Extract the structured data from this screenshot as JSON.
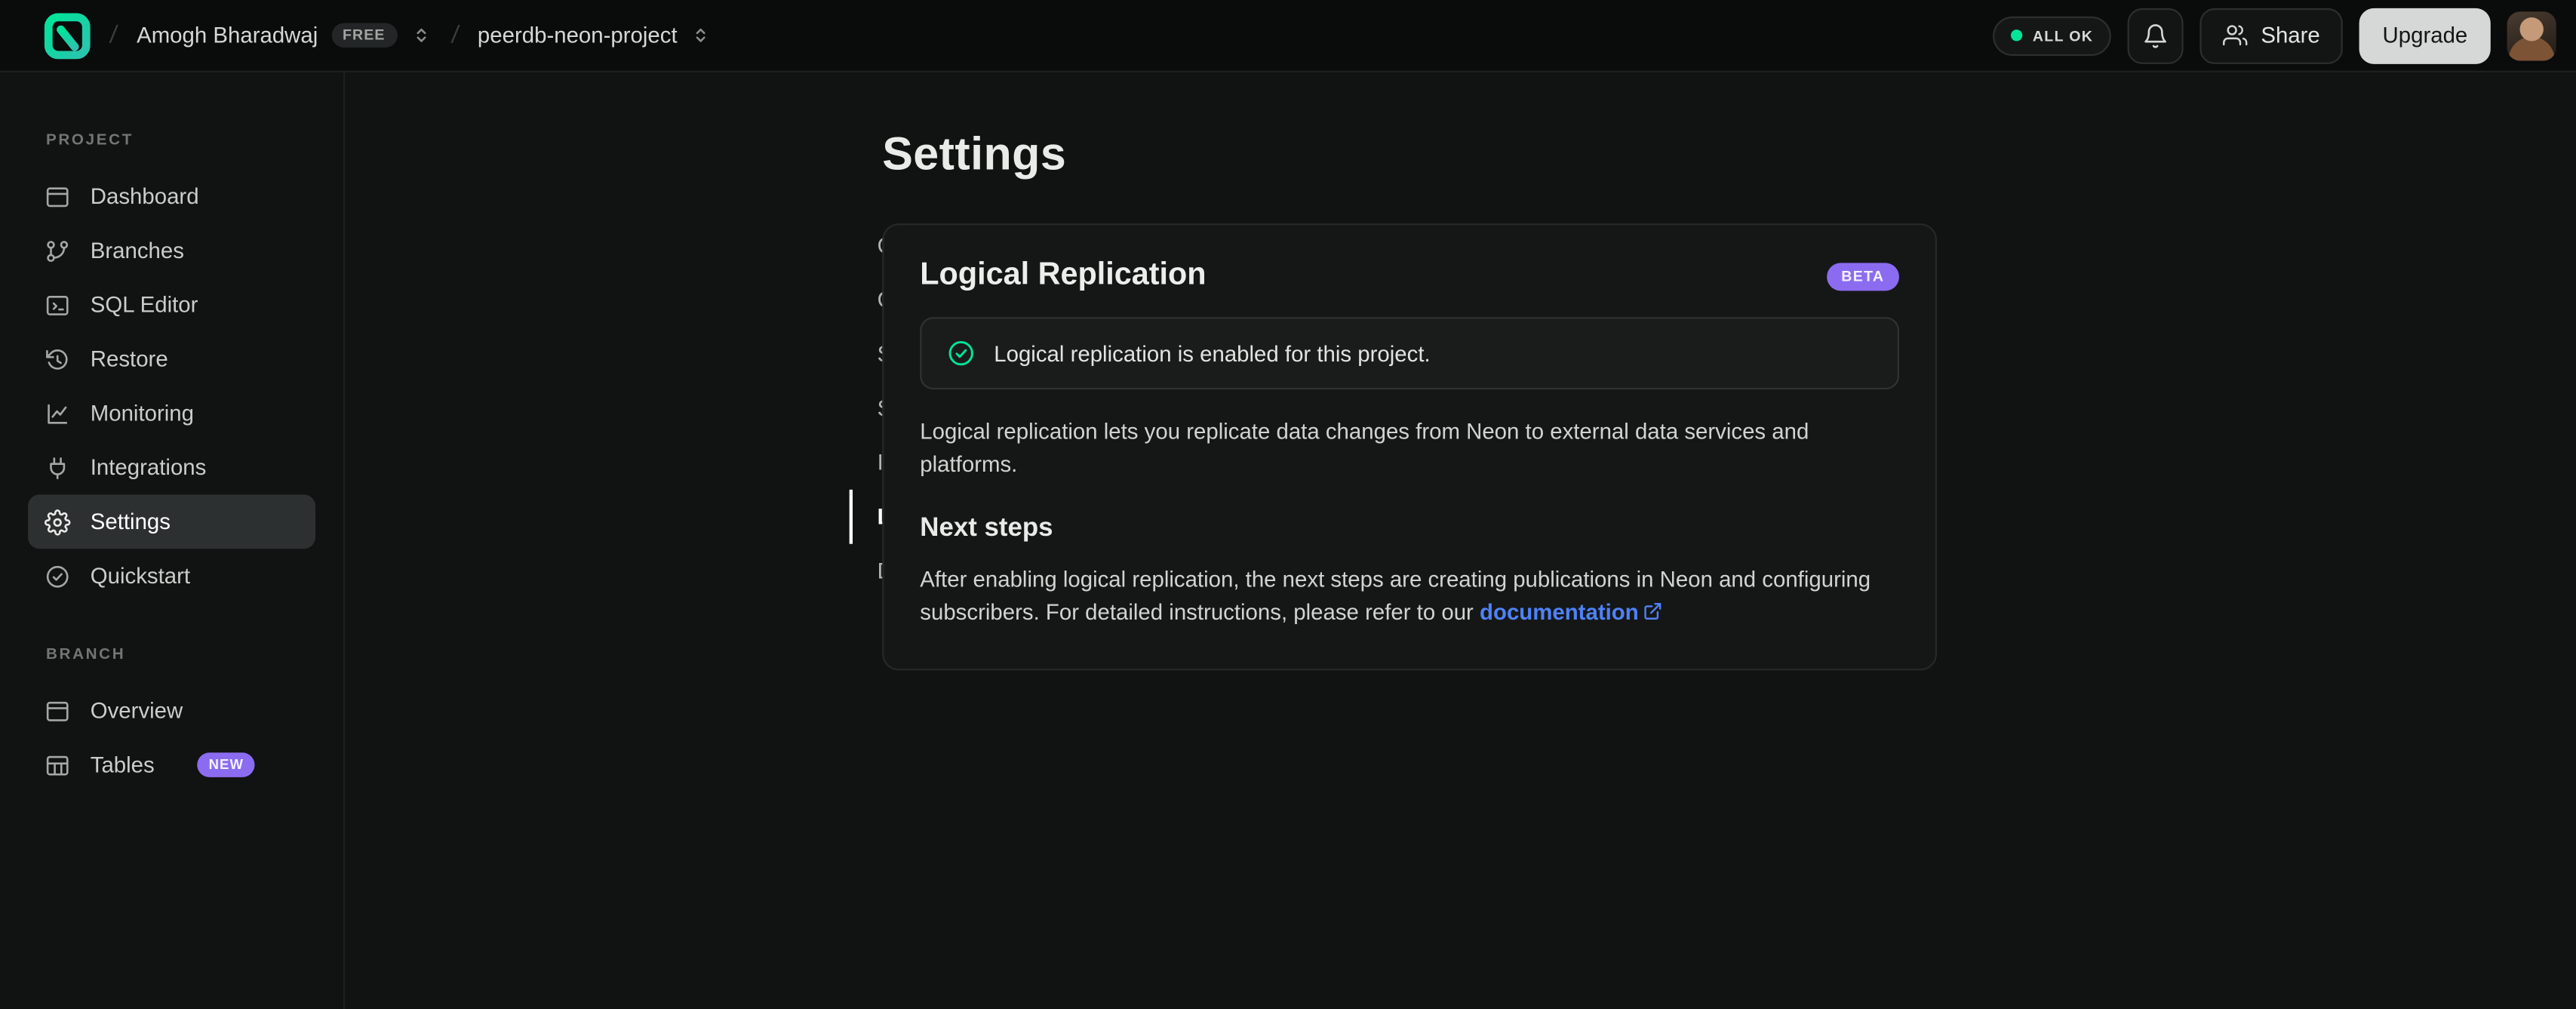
{
  "topbar": {
    "separator": "/",
    "org_name": "Amogh Bharadwaj",
    "org_badge": "FREE",
    "project_name": "peerdb-neon-project",
    "status_label": "ALL OK",
    "share_label": "Share",
    "upgrade_label": "Upgrade"
  },
  "sidebar": {
    "sections": [
      {
        "label": "PROJECT",
        "items": [
          {
            "label": "Dashboard",
            "icon": "dashboard-icon"
          },
          {
            "label": "Branches",
            "icon": "branches-icon"
          },
          {
            "label": "SQL Editor",
            "icon": "sql-editor-icon"
          },
          {
            "label": "Restore",
            "icon": "restore-icon"
          },
          {
            "label": "Monitoring",
            "icon": "monitoring-icon"
          },
          {
            "label": "Integrations",
            "icon": "integrations-icon"
          },
          {
            "label": "Settings",
            "icon": "settings-icon",
            "active": true
          },
          {
            "label": "Quickstart",
            "icon": "quickstart-icon"
          }
        ]
      },
      {
        "label": "BRANCH",
        "items": [
          {
            "label": "Overview",
            "icon": "overview-icon"
          },
          {
            "label": "Tables",
            "icon": "tables-icon",
            "badge": "NEW"
          }
        ]
      }
    ]
  },
  "main": {
    "title": "Settings",
    "subnav": [
      "General",
      "Compute",
      "Storage",
      "Sharing",
      "IP Allow",
      "Logical Replication",
      "Delete"
    ],
    "subnav_active": "Logical Replication",
    "card": {
      "title": "Logical Replication",
      "badge": "BETA",
      "banner_text": "Logical replication is enabled for this project.",
      "description": "Logical replication lets you replicate data changes from Neon to external data services and platforms.",
      "next_steps_title": "Next steps",
      "next_steps_text_before": "After enabling logical replication, the next steps are creating publications in Neon and configuring subscribers. For detailed instructions, please refer to our ",
      "next_steps_link": "documentation"
    }
  },
  "colors": {
    "accent_green": "#00e599",
    "badge_purple": "#8b6cf0",
    "link_blue": "#4e82f7"
  }
}
